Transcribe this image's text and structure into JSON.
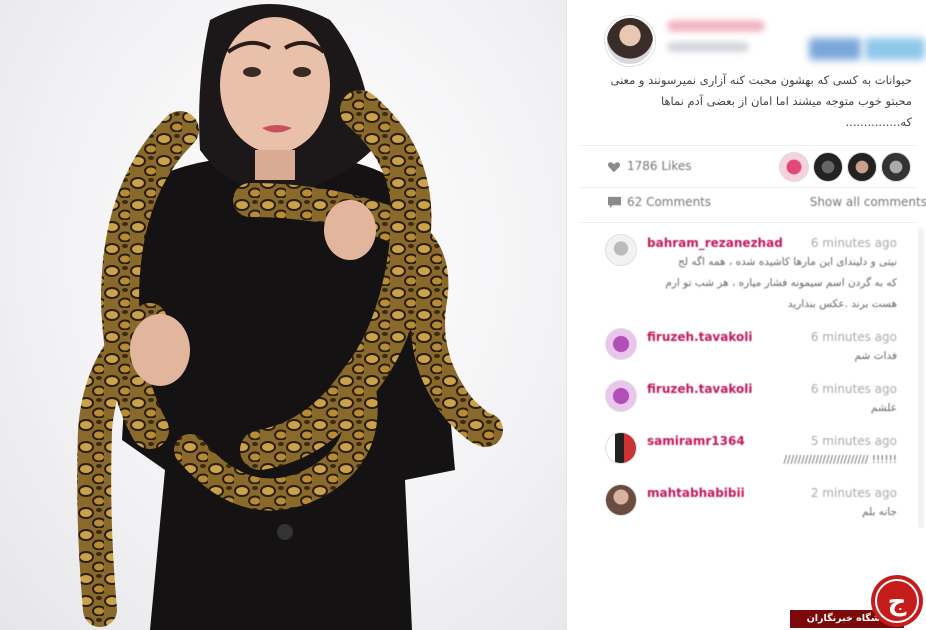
{
  "post": {
    "caption_lines": [
      "حیوانات به کسی که بهشون محبت کنه آزاری نمیرسونند و معنی",
      "محبتو خوب متوجه میشند اما امان از بعضی آدم نماها",
      "که..............."
    ]
  },
  "stats": {
    "likes": "1786 Likes",
    "comments": "62 Comments",
    "show_all": "Show all comments"
  },
  "comments": [
    {
      "user": "bahram_rezanezhad",
      "time": "6 minutes ago",
      "text": [
        "نیتی و دلیندای این مارها کاشیده شده ، همه اگه لج",
        "که به گردن اسم سیمونه فشار میاره ، هر شب تو ارم",
        "هست برند .عکس بنذارید"
      ]
    },
    {
      "user": "firuzeh.tavakoli",
      "time": "6 minutes ago",
      "text": [
        "فدات شم"
      ]
    },
    {
      "user": "firuzeh.tavakoli",
      "time": "6 minutes ago",
      "text": [
        "علشم"
      ]
    },
    {
      "user": "samiramr1364",
      "time": "5 minutes ago",
      "text": [
        "!!!!!! ////////////////////////"
      ]
    },
    {
      "user": "mahtabhabibii",
      "time": "2 minutes ago",
      "text": [
        "جانه بلم"
      ]
    }
  ],
  "watermark": {
    "label": "باشگاه خبرنگاران",
    "logo_letter": "ج"
  },
  "colors": {
    "username": "#c2185b",
    "watermark": "#c61b1b",
    "banner": "#7d0a0a"
  }
}
